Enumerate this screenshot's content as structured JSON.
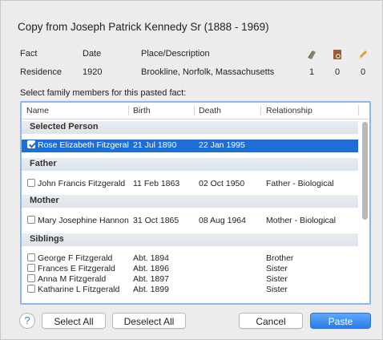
{
  "dialog": {
    "title": "Copy from Joseph Patrick Kennedy Sr (1888 - 1969)"
  },
  "fact_table": {
    "headers": {
      "fact": "Fact",
      "date": "Date",
      "place": "Place/Description"
    },
    "row": {
      "fact": "Residence",
      "date": "1920",
      "place": "Brookline, Norfolk, Massachusetts",
      "col1": "1",
      "col2": "0",
      "col3": "0"
    },
    "icons": [
      "sources-icon",
      "media-icon",
      "notes-pencil-icon"
    ]
  },
  "select_label": "Select family members for this pasted fact:",
  "columns": {
    "name": "Name",
    "birth": "Birth",
    "death": "Death",
    "relationship": "Relationship"
  },
  "groups": {
    "selected": {
      "label": "Selected Person",
      "rows": [
        {
          "name": "Rose Elizabeth Fitzgerald",
          "birth": "21 Jul 1890",
          "death": "22 Jan 1995",
          "relationship": "",
          "checked": true
        }
      ]
    },
    "father": {
      "label": "Father",
      "rows": [
        {
          "name": "John Francis Fitzgerald",
          "birth": "11 Feb 1863",
          "death": "02 Oct 1950",
          "relationship": "Father - Biological",
          "checked": false
        }
      ]
    },
    "mother": {
      "label": "Mother",
      "rows": [
        {
          "name": "Mary Josephine Hannon",
          "birth": "31 Oct 1865",
          "death": "08 Aug 1964",
          "relationship": "Mother - Biological",
          "checked": false
        }
      ]
    },
    "siblings": {
      "label": "Siblings",
      "rows": [
        {
          "name": "George F Fitzgerald",
          "birth": "Abt. 1894",
          "death": "",
          "relationship": "Brother",
          "checked": false
        },
        {
          "name": "Frances E Fitzgerald",
          "birth": "Abt. 1896",
          "death": "",
          "relationship": "Sister",
          "checked": false
        },
        {
          "name": "Anna M Fitzgerald",
          "birth": "Abt. 1897",
          "death": "",
          "relationship": "Sister",
          "checked": false
        },
        {
          "name": "Katharine L Fitzgerald",
          "birth": "Abt. 1899",
          "death": "",
          "relationship": "Sister",
          "checked": false
        }
      ]
    }
  },
  "buttons": {
    "help": "?",
    "select_all": "Select All",
    "deselect_all": "Deselect All",
    "cancel": "Cancel",
    "paste": "Paste"
  },
  "colors": {
    "selection": "#1c6fd4",
    "focus_ring": "#8fb8ea",
    "primary_button": "#2a7de8"
  }
}
